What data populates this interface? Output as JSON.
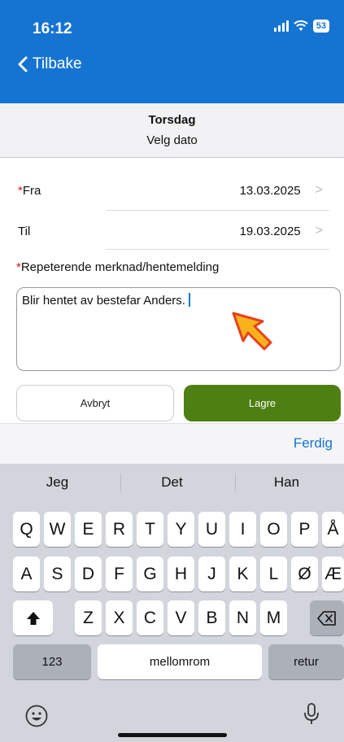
{
  "status": {
    "time": "16:12",
    "battery": "53"
  },
  "nav": {
    "back_label": "Tilbake"
  },
  "header": {
    "day": "Torsdag",
    "subtitle": "Velg dato"
  },
  "form": {
    "from_required": "*",
    "from_label": "Fra",
    "from_value": "13.03.2025",
    "to_label": "Til",
    "to_value": "19.03.2025",
    "memo_required": "*",
    "memo_label": "Repeterende merknad/hentemelding",
    "memo_value": "Blir hentet av bestefar Anders."
  },
  "buttons": {
    "cancel": "Avbryt",
    "save": "Lagre"
  },
  "keyboard_toolbar": {
    "done": "Ferdig"
  },
  "keyboard": {
    "suggestions": [
      "Jeg",
      "Det",
      "Han"
    ],
    "row1": [
      "Q",
      "W",
      "E",
      "R",
      "T",
      "Y",
      "U",
      "I",
      "O",
      "P",
      "Å"
    ],
    "row2": [
      "A",
      "S",
      "D",
      "F",
      "G",
      "H",
      "J",
      "K",
      "L",
      "Ø",
      "Æ"
    ],
    "row3": [
      "Z",
      "X",
      "C",
      "V",
      "B",
      "N",
      "M"
    ],
    "numbers": "123",
    "space": "mellomrom",
    "return": "retur"
  },
  "colors": {
    "accent": "#1574d1",
    "save": "#4e7f12",
    "required": "#d01818"
  },
  "icons": [
    "back-chevron-icon",
    "signal-icon",
    "wifi-icon",
    "battery-icon",
    "chevron-right-icon",
    "shift-icon",
    "backspace-icon",
    "emoji-icon",
    "microphone-icon",
    "pointer-arrow-icon"
  ]
}
